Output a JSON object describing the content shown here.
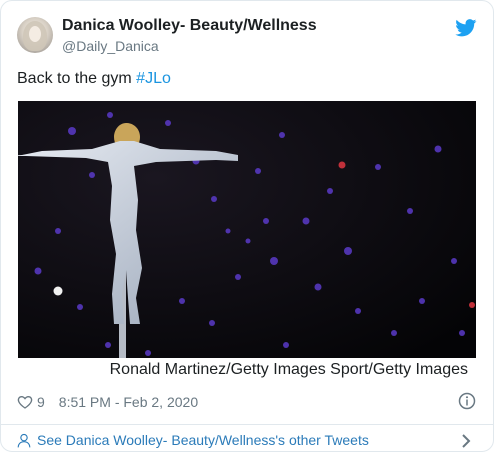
{
  "author": {
    "display_name": "Danica Woolley- Beauty/Wellness",
    "handle": "@Daily_Danica"
  },
  "tweet": {
    "text": "Back to the gym ",
    "hashtag": "#JLo",
    "image_credit": "Ronald Martinez/Getty Images Sport/Getty Images",
    "like_count": "9",
    "timestamp": "8:51 PM - Feb 2, 2020"
  },
  "footer": {
    "link_label": "See Danica Woolley- Beauty/Wellness's other Tweets"
  },
  "colors": {
    "link_blue": "#1b95e0",
    "footer_blue": "#2b7bb9",
    "muted_gray": "#697882",
    "border": "#e1e8ed"
  },
  "icons": [
    "twitter-bird-icon",
    "heart-icon",
    "info-icon",
    "person-icon",
    "chevron-right-icon"
  ]
}
